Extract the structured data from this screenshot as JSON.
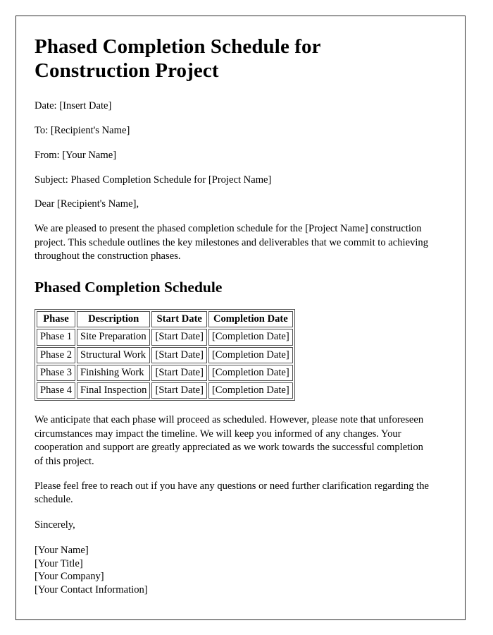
{
  "document": {
    "title": "Phased Completion Schedule for Construction Project",
    "meta": {
      "date": "Date: [Insert Date]",
      "to": "To: [Recipient's Name]",
      "from": "From: [Your Name]",
      "subject": "Subject: Phased Completion Schedule for [Project Name]",
      "salutation": "Dear [Recipient's Name],"
    },
    "intro_paragraph": "We are pleased to present the phased completion schedule for the [Project Name] construction project. This schedule outlines the key milestones and deliverables that we commit to achieving throughout the construction phases.",
    "section_heading": "Phased Completion Schedule",
    "table": {
      "headers": [
        "Phase",
        "Description",
        "Start Date",
        "Completion Date"
      ],
      "rows": [
        [
          "Phase 1",
          "Site Preparation",
          "[Start Date]",
          "[Completion Date]"
        ],
        [
          "Phase 2",
          "Structural Work",
          "[Start Date]",
          "[Completion Date]"
        ],
        [
          "Phase 3",
          "Finishing Work",
          "[Start Date]",
          "[Completion Date]"
        ],
        [
          "Phase 4",
          "Final Inspection",
          "[Start Date]",
          "[Completion Date]"
        ]
      ]
    },
    "closing_paragraph_1": "We anticipate that each phase will proceed as scheduled. However, please note that unforeseen circumstances may impact the timeline. We will keep you informed of any changes. Your cooperation and support are greatly appreciated as we work towards the successful completion of this project.",
    "closing_paragraph_2": "Please feel free to reach out if you have any questions or need further clarification regarding the schedule.",
    "sign_off": "Sincerely,",
    "signature": {
      "name": "[Your Name]",
      "title": "[Your Title]",
      "company": "[Your Company]",
      "contact": "[Your Contact Information]"
    }
  },
  "colors": {
    "text": "#000000",
    "page_border": "#2b2b2b",
    "table_border": "#555555",
    "background": "#ffffff"
  }
}
